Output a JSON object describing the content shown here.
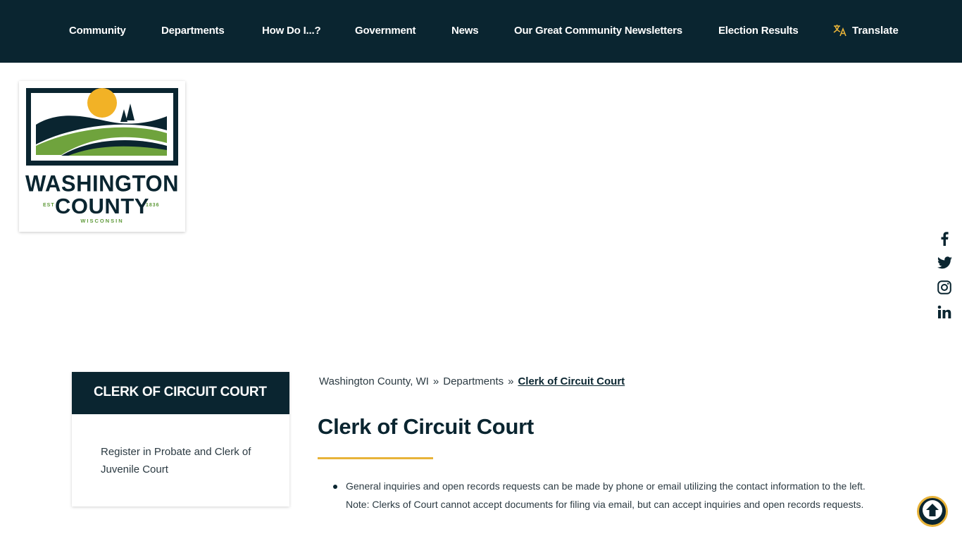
{
  "nav": {
    "items": [
      {
        "label": "Community"
      },
      {
        "label": "Departments"
      },
      {
        "label": "How Do I...?"
      },
      {
        "label": "Government"
      },
      {
        "label": "News"
      },
      {
        "label": "Our Great Community Newsletters"
      },
      {
        "label": "Election Results"
      }
    ],
    "translate_label": "Translate",
    "translate_icon": "translate-icon"
  },
  "logo": {
    "line1": "WASHINGTON",
    "line2": "COUNTY",
    "est": "EST",
    "year": "1836",
    "state": "WISCONSIN"
  },
  "social": [
    "facebook-icon",
    "twitter-icon",
    "instagram-icon",
    "linkedin-icon"
  ],
  "sidebar": {
    "heading": "CLERK OF CIRCUIT COURT",
    "links": [
      {
        "label": "Register in Probate and Clerk of Juvenile Court"
      }
    ]
  },
  "breadcrumb": {
    "items": [
      "Washington County, WI",
      "Departments",
      "Clerk of Circuit Court"
    ],
    "separator": "»"
  },
  "page": {
    "title": "Clerk of Circuit Court",
    "bullets": [
      {
        "text": "General inquiries and open records requests can be made by phone or email utilizing the contact information to the left.",
        "note": "Note: Clerks of Court cannot accept documents for filing via email, but can accept inquiries and open records requests."
      }
    ]
  },
  "colors": {
    "navy": "#0a2530",
    "gold": "#e8b339",
    "green": "#5f9a3a"
  }
}
